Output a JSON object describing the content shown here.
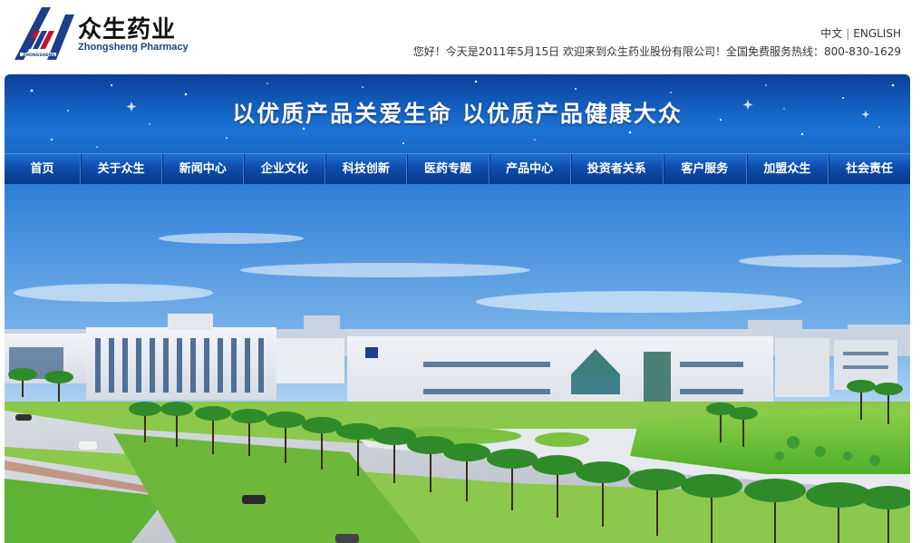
{
  "brand": {
    "name_cn": "众生药业",
    "name_en": "Zhongsheng Pharmacy",
    "logo_tag": "ZHONGSHENG",
    "colors": {
      "primary_blue": "#1d3f8a",
      "accent_red": "#c8102e"
    }
  },
  "header": {
    "lang_cn": "中文",
    "lang_sep": "|",
    "lang_en": "ENGLISH",
    "greeting": "您好！今天是2011年5月15日  欢迎来到众生药业股份有限公司！全国免费服务热线：800-830-1629"
  },
  "banner": {
    "slogan": "以优质产品关爱生命 以优质产品健康大众",
    "colors": {
      "top": "#0a3f9a",
      "bottom": "#1d73d4"
    }
  },
  "nav": {
    "items": [
      {
        "label": "首页"
      },
      {
        "label": "关于众生"
      },
      {
        "label": "新闻中心"
      },
      {
        "label": "企业文化"
      },
      {
        "label": "科技创新"
      },
      {
        "label": "医药专题"
      },
      {
        "label": "产品中心"
      },
      {
        "label": "投资者关系"
      },
      {
        "label": "客户服务"
      },
      {
        "label": "加盟众生"
      },
      {
        "label": "社会责任"
      }
    ]
  },
  "hero": {
    "image": "factory-campus-photo"
  }
}
